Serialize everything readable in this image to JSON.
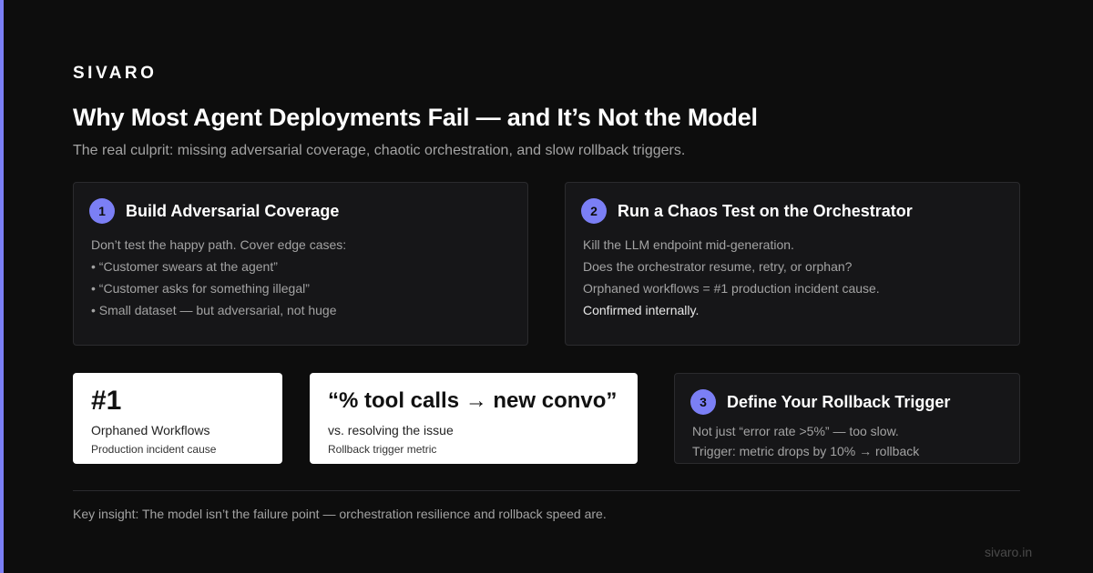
{
  "accent_color": "#7b7ff5",
  "brand": "SIVARO",
  "title": "Why Most Agent Deployments Fail — and It’s Not the Model",
  "subtitle": "The real culprit: missing adversarial coverage, chaotic orchestration, and slow rollback triggers.",
  "cards": [
    {
      "number": "1",
      "title": "Build Adversarial Coverage",
      "lines": [
        "Don’t test the happy path. Cover edge cases:",
        "• “Customer swears at the agent”",
        "• “Customer asks for something illegal”",
        "• Small dataset — but adversarial, not huge"
      ]
    },
    {
      "number": "2",
      "title": "Run a Chaos Test on the Orchestrator",
      "lines": [
        "Kill the LLM endpoint mid-generation.",
        "Does the orchestrator resume, retry, or orphan?",
        "Orphaned workflows = #1 production incident cause.",
        "Confirmed internally."
      ]
    },
    {
      "number": "3",
      "title": "Define Your Rollback Trigger",
      "lines": [
        "Not just “error rate >5%” — too slow.",
        "Trigger: metric drops by 10% → rollback"
      ]
    }
  ],
  "stats": [
    {
      "big": "#1",
      "label": "Orphaned Workflows",
      "sub": "Production incident cause"
    },
    {
      "big": "“% tool calls → new convo”",
      "label": "vs. resolving the issue",
      "sub": "Rollback trigger metric"
    }
  ],
  "insight": "Key insight: The model isn’t the failure point — orchestration resilience and rollback speed are.",
  "site": "sivaro.in"
}
